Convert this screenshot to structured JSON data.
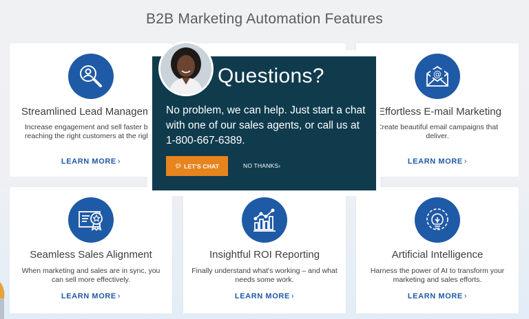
{
  "page": {
    "title": "B2B Marketing Automation Features"
  },
  "colors": {
    "brand_blue": "#1f5aa6",
    "modal_bg": "#0f3b4d",
    "chat_button": "#e7841d"
  },
  "cards": [
    {
      "title": "Streamlined Lead Manageme",
      "description": "Increase engagement and sell faster by reaching the right customers at the righ time.",
      "link": "LEARN MORE",
      "icon": "magnifier-person-icon"
    },
    {
      "title": "",
      "description": "",
      "link": "",
      "icon": "hidden-icon"
    },
    {
      "title": "Effortless E-mail Marketing",
      "description": "Create beautiful email campaigns that deliver.",
      "link": "LEARN MORE",
      "icon": "envelope-icon"
    },
    {
      "title": "Seamless Sales Alignment",
      "description": "When marketing and sales are in sync, you can sell more effectively.",
      "link": "LEARN MORE",
      "icon": "certificate-icon"
    },
    {
      "title": "Insightful ROI Reporting",
      "description": "Finally understand what's working – and what needs some work.",
      "link": "LEARN MORE",
      "icon": "bar-chart-icon"
    },
    {
      "title": "Artificial Intelligence",
      "description": "Harness the power of AI to transform your marketing and sales efforts.",
      "link": "LEARN MORE",
      "icon": "lightbulb-gear-icon"
    }
  ],
  "modal": {
    "title": "Questions?",
    "body": "No problem, we can help. Just start a chat with one of our sales agents, or call us at 1-800-667-6389.",
    "chat_button": "LET'S CHAT",
    "dismiss": "NO THANKS"
  }
}
